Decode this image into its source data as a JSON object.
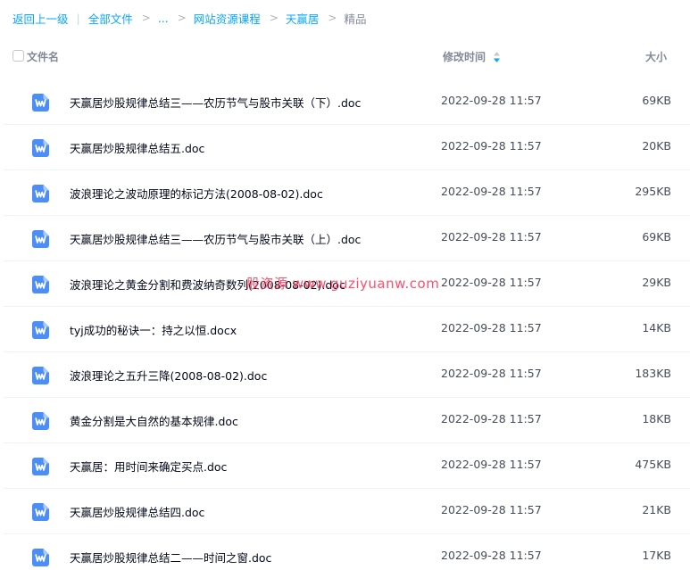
{
  "breadcrumb": {
    "back": "返回上一级",
    "pipe": "|",
    "all_files": "全部文件",
    "sep": ">",
    "ellipsis": "...",
    "course": "网站资源课程",
    "folder": "天赢居",
    "current": "精品"
  },
  "header": {
    "name": "文件名",
    "modified": "修改时间",
    "size": "大小"
  },
  "colors": {
    "accent": "#06a7ff",
    "icon_blue": "#4b8ef7",
    "watermark": "#ff3a5c"
  },
  "files": [
    {
      "icon": "word-doc-icon",
      "name": "天赢居炒股规律总结三——农历节气与股市关联（下）.doc",
      "time": "2022-09-28 11:57",
      "size": "69KB"
    },
    {
      "icon": "word-doc-icon",
      "name": "天赢居炒股规律总结五.doc",
      "time": "2022-09-28 11:57",
      "size": "20KB"
    },
    {
      "icon": "word-doc-icon",
      "name": "波浪理论之波动原理的标记方法(2008-08-02).doc",
      "time": "2022-09-28 11:57",
      "size": "295KB"
    },
    {
      "icon": "word-doc-icon",
      "name": "天赢居炒股规律总结三——农历节气与股市关联（上）.doc",
      "time": "2022-09-28 11:57",
      "size": "69KB"
    },
    {
      "icon": "word-doc-icon",
      "name": "波浪理论之黄金分割和费波纳奇数列(2008-08-02).doc",
      "time": "2022-09-28 11:57",
      "size": "29KB"
    },
    {
      "icon": "word-doc-icon",
      "name": "tyj成功的秘诀一：持之以恒.docx",
      "time": "2022-09-28 11:57",
      "size": "14KB"
    },
    {
      "icon": "word-doc-icon",
      "name": "波浪理论之五升三降(2008-08-02).doc",
      "time": "2022-09-28 11:57",
      "size": "183KB"
    },
    {
      "icon": "word-doc-icon",
      "name": "黄金分割是大自然的基本规律.doc",
      "time": "2022-09-28 11:57",
      "size": "18KB"
    },
    {
      "icon": "word-doc-icon",
      "name": "天赢居：用时间来确定买点.doc",
      "time": "2022-09-28 11:57",
      "size": "475KB"
    },
    {
      "icon": "word-doc-icon",
      "name": "天赢居炒股规律总结四.doc",
      "time": "2022-09-28 11:57",
      "size": "21KB"
    },
    {
      "icon": "word-doc-icon",
      "name": "天赢居炒股规律总结二——时间之窗.doc",
      "time": "2022-09-28 11:57",
      "size": "17KB"
    }
  ],
  "watermark": "股资源 www.guziyuanw.com"
}
